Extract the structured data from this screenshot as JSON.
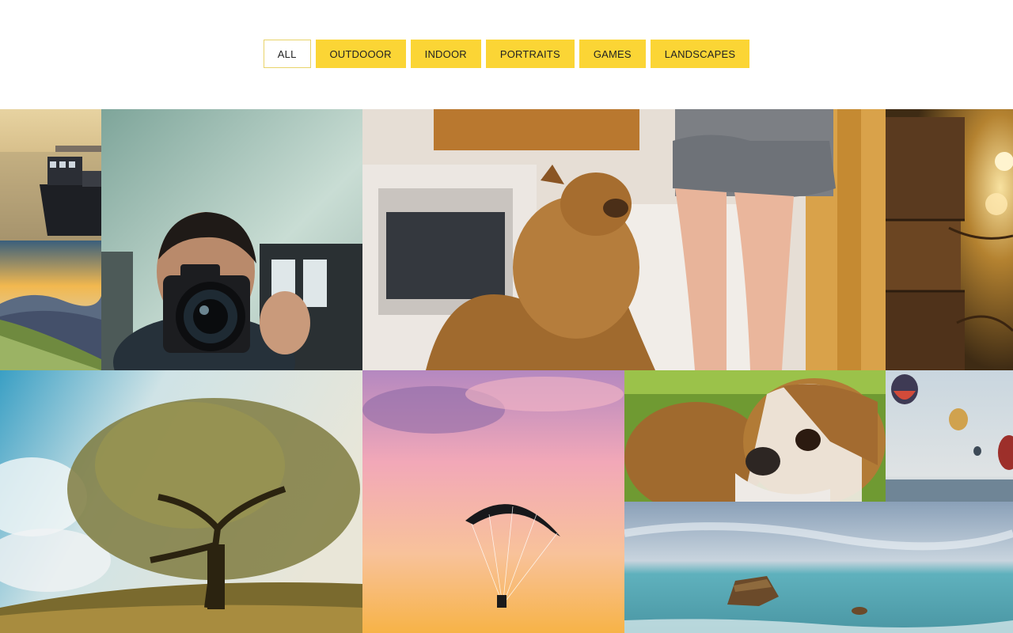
{
  "filters": {
    "items": [
      {
        "label": "ALL",
        "active": true
      },
      {
        "label": "OUTDOOOR",
        "active": false
      },
      {
        "label": "INDOOR",
        "active": false
      },
      {
        "label": "PORTRAITS",
        "active": false
      },
      {
        "label": "GAMES",
        "active": false
      },
      {
        "label": "LANDSCAPES",
        "active": false
      }
    ]
  },
  "gallery": {
    "photos": [
      {
        "subject": "ferry-boat-at-sunset"
      },
      {
        "subject": "mountain-sunset"
      },
      {
        "subject": "camera-selfie"
      },
      {
        "subject": "dog-in-kitchen"
      },
      {
        "subject": "fairy-lights-on-brick-wall"
      },
      {
        "subject": "lone-tree"
      },
      {
        "subject": "paraglider-sunset"
      },
      {
        "subject": "bulldog"
      },
      {
        "subject": "hot-air-balloons"
      },
      {
        "subject": "sea-rock"
      }
    ]
  },
  "colors": {
    "accent": "#fbd535",
    "active_border": "#e9d36a"
  }
}
